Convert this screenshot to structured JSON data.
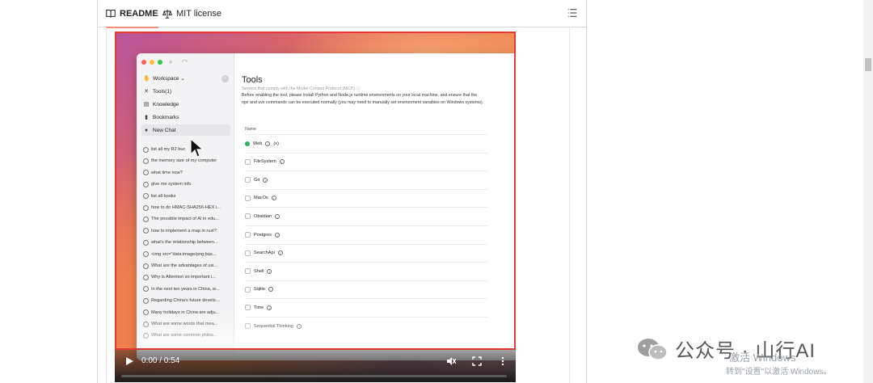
{
  "tabs": {
    "readme": "README",
    "license": "MIT license"
  },
  "app": {
    "sidebar": {
      "workspace": "Workspace ⌄",
      "items": [
        "Tools(1)",
        "Knowledge",
        "Bookmarks",
        "New Chat"
      ],
      "chats": [
        "list all my R2 buc",
        "the memory size of my computer",
        "what time now?",
        "give me system info",
        "list all books",
        "how to do HMAC-SHA256-HEX i...",
        "The possible impact of AI in edu...",
        "how to implement a map in rust?",
        "what's the relationship between...",
        "<img src=\"data:image/png;bas...",
        "What are the advantages of usi...",
        "Why is Attention so important i...",
        "In the next ten years in China, w...",
        "Regarding China's future develo...",
        "Many holidays in China are adju...",
        "What are some words that mea...",
        "What are some common philos..."
      ]
    },
    "main": {
      "title": "Tools",
      "subtitle": "Servers that comply with the Model Context Protocol (MCP) ⓘ",
      "description": "Before enabling the tool, please install Python and Node.js runtime environments on your local machine, and ensure that the npx and uvx commands can be executed normally (you may need to manually set environment variables on Windows systems).",
      "column_name": "Name",
      "tools": [
        {
          "name": "Web",
          "enabled": true,
          "extra": "(x)"
        },
        {
          "name": "FileSystem",
          "enabled": false,
          "extra": ""
        },
        {
          "name": "Git",
          "enabled": false,
          "extra": ""
        },
        {
          "name": "MacOs",
          "enabled": false,
          "extra": ""
        },
        {
          "name": "Obsidian",
          "enabled": false,
          "extra": ""
        },
        {
          "name": "Postgres",
          "enabled": false,
          "extra": ""
        },
        {
          "name": "SearchApi",
          "enabled": false,
          "extra": ""
        },
        {
          "name": "Shell",
          "enabled": false,
          "extra": ""
        },
        {
          "name": "Sqlite",
          "enabled": false,
          "extra": ""
        },
        {
          "name": "Time",
          "enabled": false,
          "extra": ""
        },
        {
          "name": "Sequential Thinking",
          "enabled": false,
          "extra": ""
        }
      ]
    }
  },
  "player": {
    "time": "0:00 / 0:54",
    "progress": 0
  },
  "watermark": {
    "text": "公众号 · 山行AI",
    "win_title": "激活 Windows",
    "win_sub": "转到\"设置\"以激活 Windows。"
  },
  "colors": {
    "highlight_border": "#e53935",
    "tab_underline": "#fd8c73",
    "enabled_dot": "#2fb35a"
  }
}
